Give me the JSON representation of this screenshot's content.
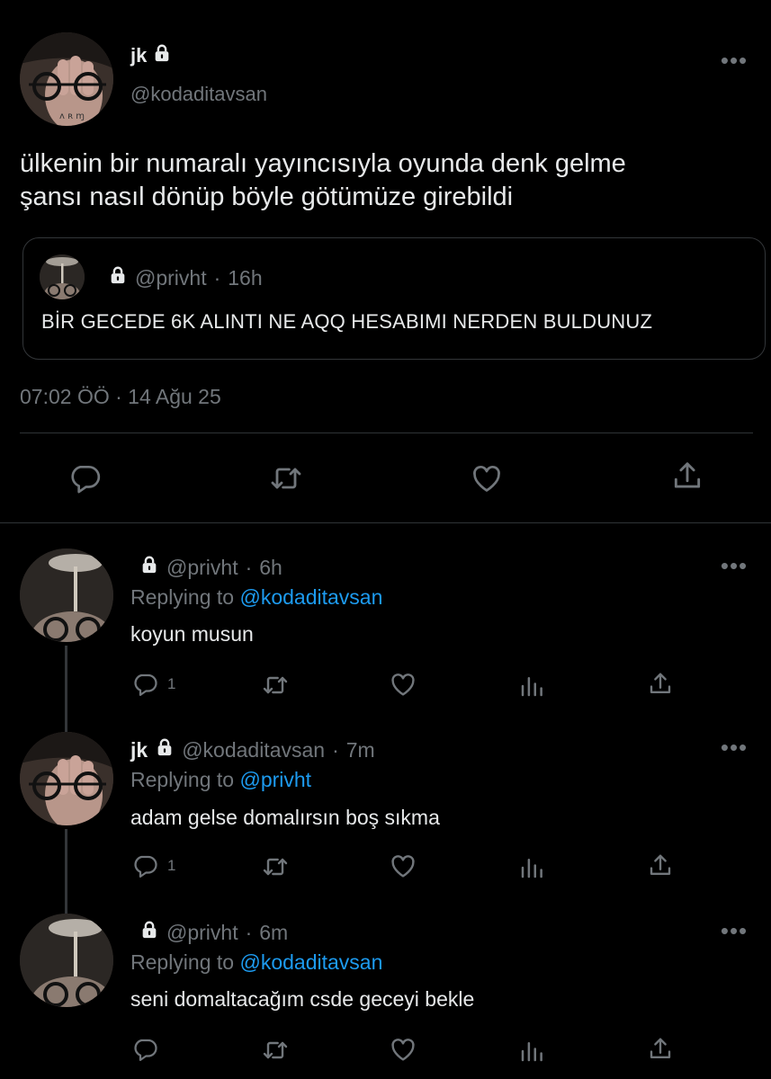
{
  "main_tweet": {
    "display_name": "jk",
    "handle": "@kodaditavsan",
    "text_line1": "ülkenin bir numaralı yayıncısıyla oyunda denk gelme",
    "text_line2": "şansı nasıl dönüp böyle götümüze girebildi",
    "timestamp": "07:02 ÖÖ · 14 Ağu 25",
    "quoted": {
      "handle": "@privht",
      "time": "16h",
      "text": "BİR GECEDE 6K ALINTI NE AQQ HESABIMI NERDEN BULDUNUZ"
    }
  },
  "replies": [
    {
      "display_name": "",
      "handle": "@privht",
      "time": "6h",
      "replying_prefix": "Replying to",
      "replying_to": "@kodaditavsan",
      "text": "koyun musun",
      "reply_count": "1"
    },
    {
      "display_name": "jk",
      "handle": "@kodaditavsan",
      "time": "7m",
      "replying_prefix": "Replying to",
      "replying_to": "@privht",
      "text": "adam gelse domalırsın boş sıkma",
      "reply_count": "1"
    },
    {
      "display_name": "",
      "handle": "@privht",
      "time": "6m",
      "replying_prefix": "Replying to",
      "replying_to": "@kodaditavsan",
      "text": "seni domaltacağım csde geceyi bekle",
      "reply_count": ""
    }
  ],
  "colors": {
    "background": "#000000",
    "text": "#e7e9ea",
    "muted": "#71767b",
    "link": "#1d9bf0",
    "divider": "#2f3336"
  },
  "icons": [
    "more-icon",
    "lock-icon",
    "reply-icon",
    "retweet-icon",
    "like-icon",
    "views-icon",
    "share-icon"
  ]
}
